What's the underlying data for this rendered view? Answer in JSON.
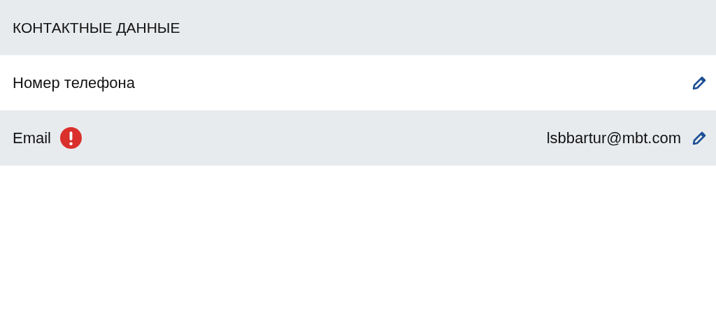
{
  "section": {
    "title": "КОНТАКТНЫЕ ДАННЫЕ"
  },
  "rows": [
    {
      "label": "Номер телефона",
      "warning": false
    },
    {
      "label": "Email",
      "warning": true,
      "value": "lsbbartur@mbt.com"
    }
  ]
}
